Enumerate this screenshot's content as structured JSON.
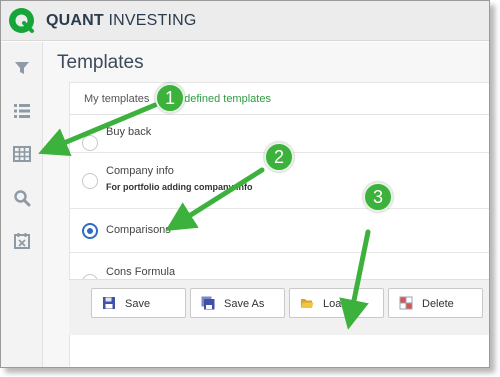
{
  "app": {
    "brand_bold": "QUANT",
    "brand_light": " INVESTING"
  },
  "sidebar": {
    "icons": [
      "filter-icon",
      "list-icon",
      "grid-table-icon",
      "search-icon",
      "calendar-icon"
    ]
  },
  "page": {
    "title": "Templates"
  },
  "tabs": {
    "my": "My templates",
    "predefined": "edefined templates"
  },
  "rows": [
    {
      "title": "Buy back",
      "subtitle": "",
      "checked": false
    },
    {
      "title": "Company info",
      "subtitle": "For portfolio adding company info",
      "checked": false
    },
    {
      "title": "Comparisons",
      "subtitle": "",
      "checked": true
    },
    {
      "title": "Cons Formula",
      "subtitle": "",
      "checked": false
    }
  ],
  "toolbar": {
    "save": "Save",
    "save_as": "Save As",
    "load": "Load",
    "delete": "Delete"
  },
  "callouts": [
    "1",
    "2",
    "3"
  ],
  "colors": {
    "accent_green": "#3cb13c",
    "radio_blue": "#2f6dc0",
    "brand_text": "#2b3b4e"
  }
}
